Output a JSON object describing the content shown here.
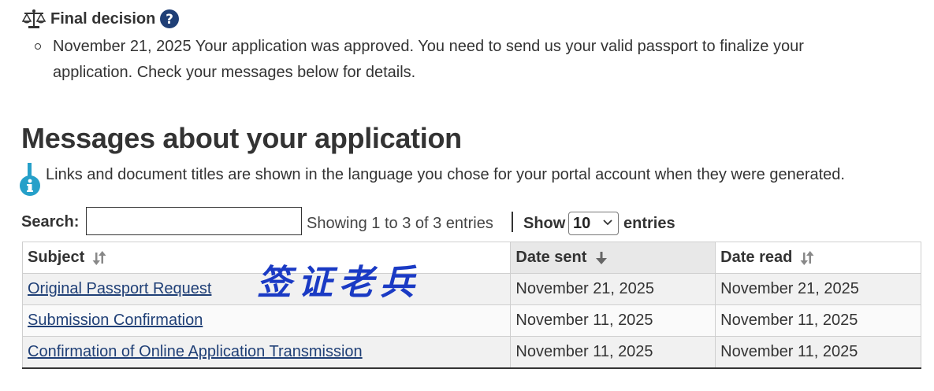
{
  "decision": {
    "icon": "balance-scale-icon",
    "title": "Final decision",
    "help_icon": "question-circle-icon",
    "items": [
      "November 21, 2025 Your application was approved. You need to send us your valid passport to finalize your application. Check your messages below for details."
    ]
  },
  "messages": {
    "heading": "Messages about your application",
    "info_icon": "info-icon",
    "info_text": "Links and document titles are shown in the language you chose for your portal account when they were generated.",
    "search_label": "Search:",
    "search_value": "",
    "showing_text": "Showing 1 to 3 of 3 entries",
    "show_label": "Show",
    "page_size": "10",
    "entries_label": "entries",
    "columns": [
      "Subject",
      "Date sent",
      "Date read"
    ],
    "rows": [
      {
        "subject": "Original Passport Request",
        "date_sent": "November 21, 2025",
        "date_read": "November 21, 2025"
      },
      {
        "subject": "Submission Confirmation",
        "date_sent": "November 11, 2025",
        "date_read": "November 11, 2025"
      },
      {
        "subject": "Confirmation of Online Application Transmission",
        "date_sent": "November 11, 2025",
        "date_read": "November 11, 2025"
      }
    ]
  },
  "watermark": "签证老兵",
  "colors": {
    "text": "#333333",
    "link": "#1f3f76",
    "info_accent": "#26a0c9",
    "help_icon": "#1f3f76",
    "watermark": "#1a3ac4",
    "sorted_header_bg": "#e8e8e8"
  }
}
